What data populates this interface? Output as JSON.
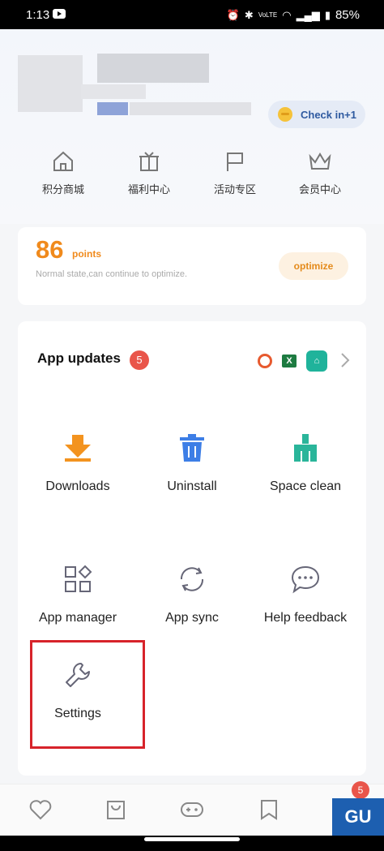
{
  "status_bar": {
    "time": "1:13",
    "network": "VoLTE",
    "battery": "85%"
  },
  "header": {
    "checkin_label": "Check in+1"
  },
  "quick_links": [
    {
      "label": "积分商城",
      "icon": "home-icon"
    },
    {
      "label": "福利中心",
      "icon": "gift-icon"
    },
    {
      "label": "活动专区",
      "icon": "flag-icon"
    },
    {
      "label": "会员中心",
      "icon": "crown-icon"
    }
  ],
  "points": {
    "value": "86",
    "unit": "points",
    "description": "Normal state,can continue to optimize.",
    "optimize_label": "optimize"
  },
  "app_updates": {
    "title": "App updates",
    "count": "5",
    "icons": [
      "opera-icon",
      "excel-icon",
      "mi-home-icon"
    ]
  },
  "tools": [
    {
      "label": "Downloads",
      "icon": "download-icon"
    },
    {
      "label": "Uninstall",
      "icon": "trash-icon"
    },
    {
      "label": "Space clean",
      "icon": "broom-icon"
    },
    {
      "label": "App manager",
      "icon": "grid-icon"
    },
    {
      "label": "App sync",
      "icon": "sync-icon"
    },
    {
      "label": "Help feedback",
      "icon": "chat-icon"
    },
    {
      "label": "Settings",
      "icon": "wrench-icon"
    }
  ],
  "bottom_nav": {
    "items": [
      "heart-icon",
      "bag-icon",
      "gamepad-icon",
      "bookmark-icon",
      "profile-icon"
    ],
    "badge": "5"
  },
  "colors": {
    "accent_orange": "#f08a1c",
    "badge_red": "#e9554a",
    "highlight_red": "#d7232a",
    "checkin_blue": "#2f5aa0"
  }
}
